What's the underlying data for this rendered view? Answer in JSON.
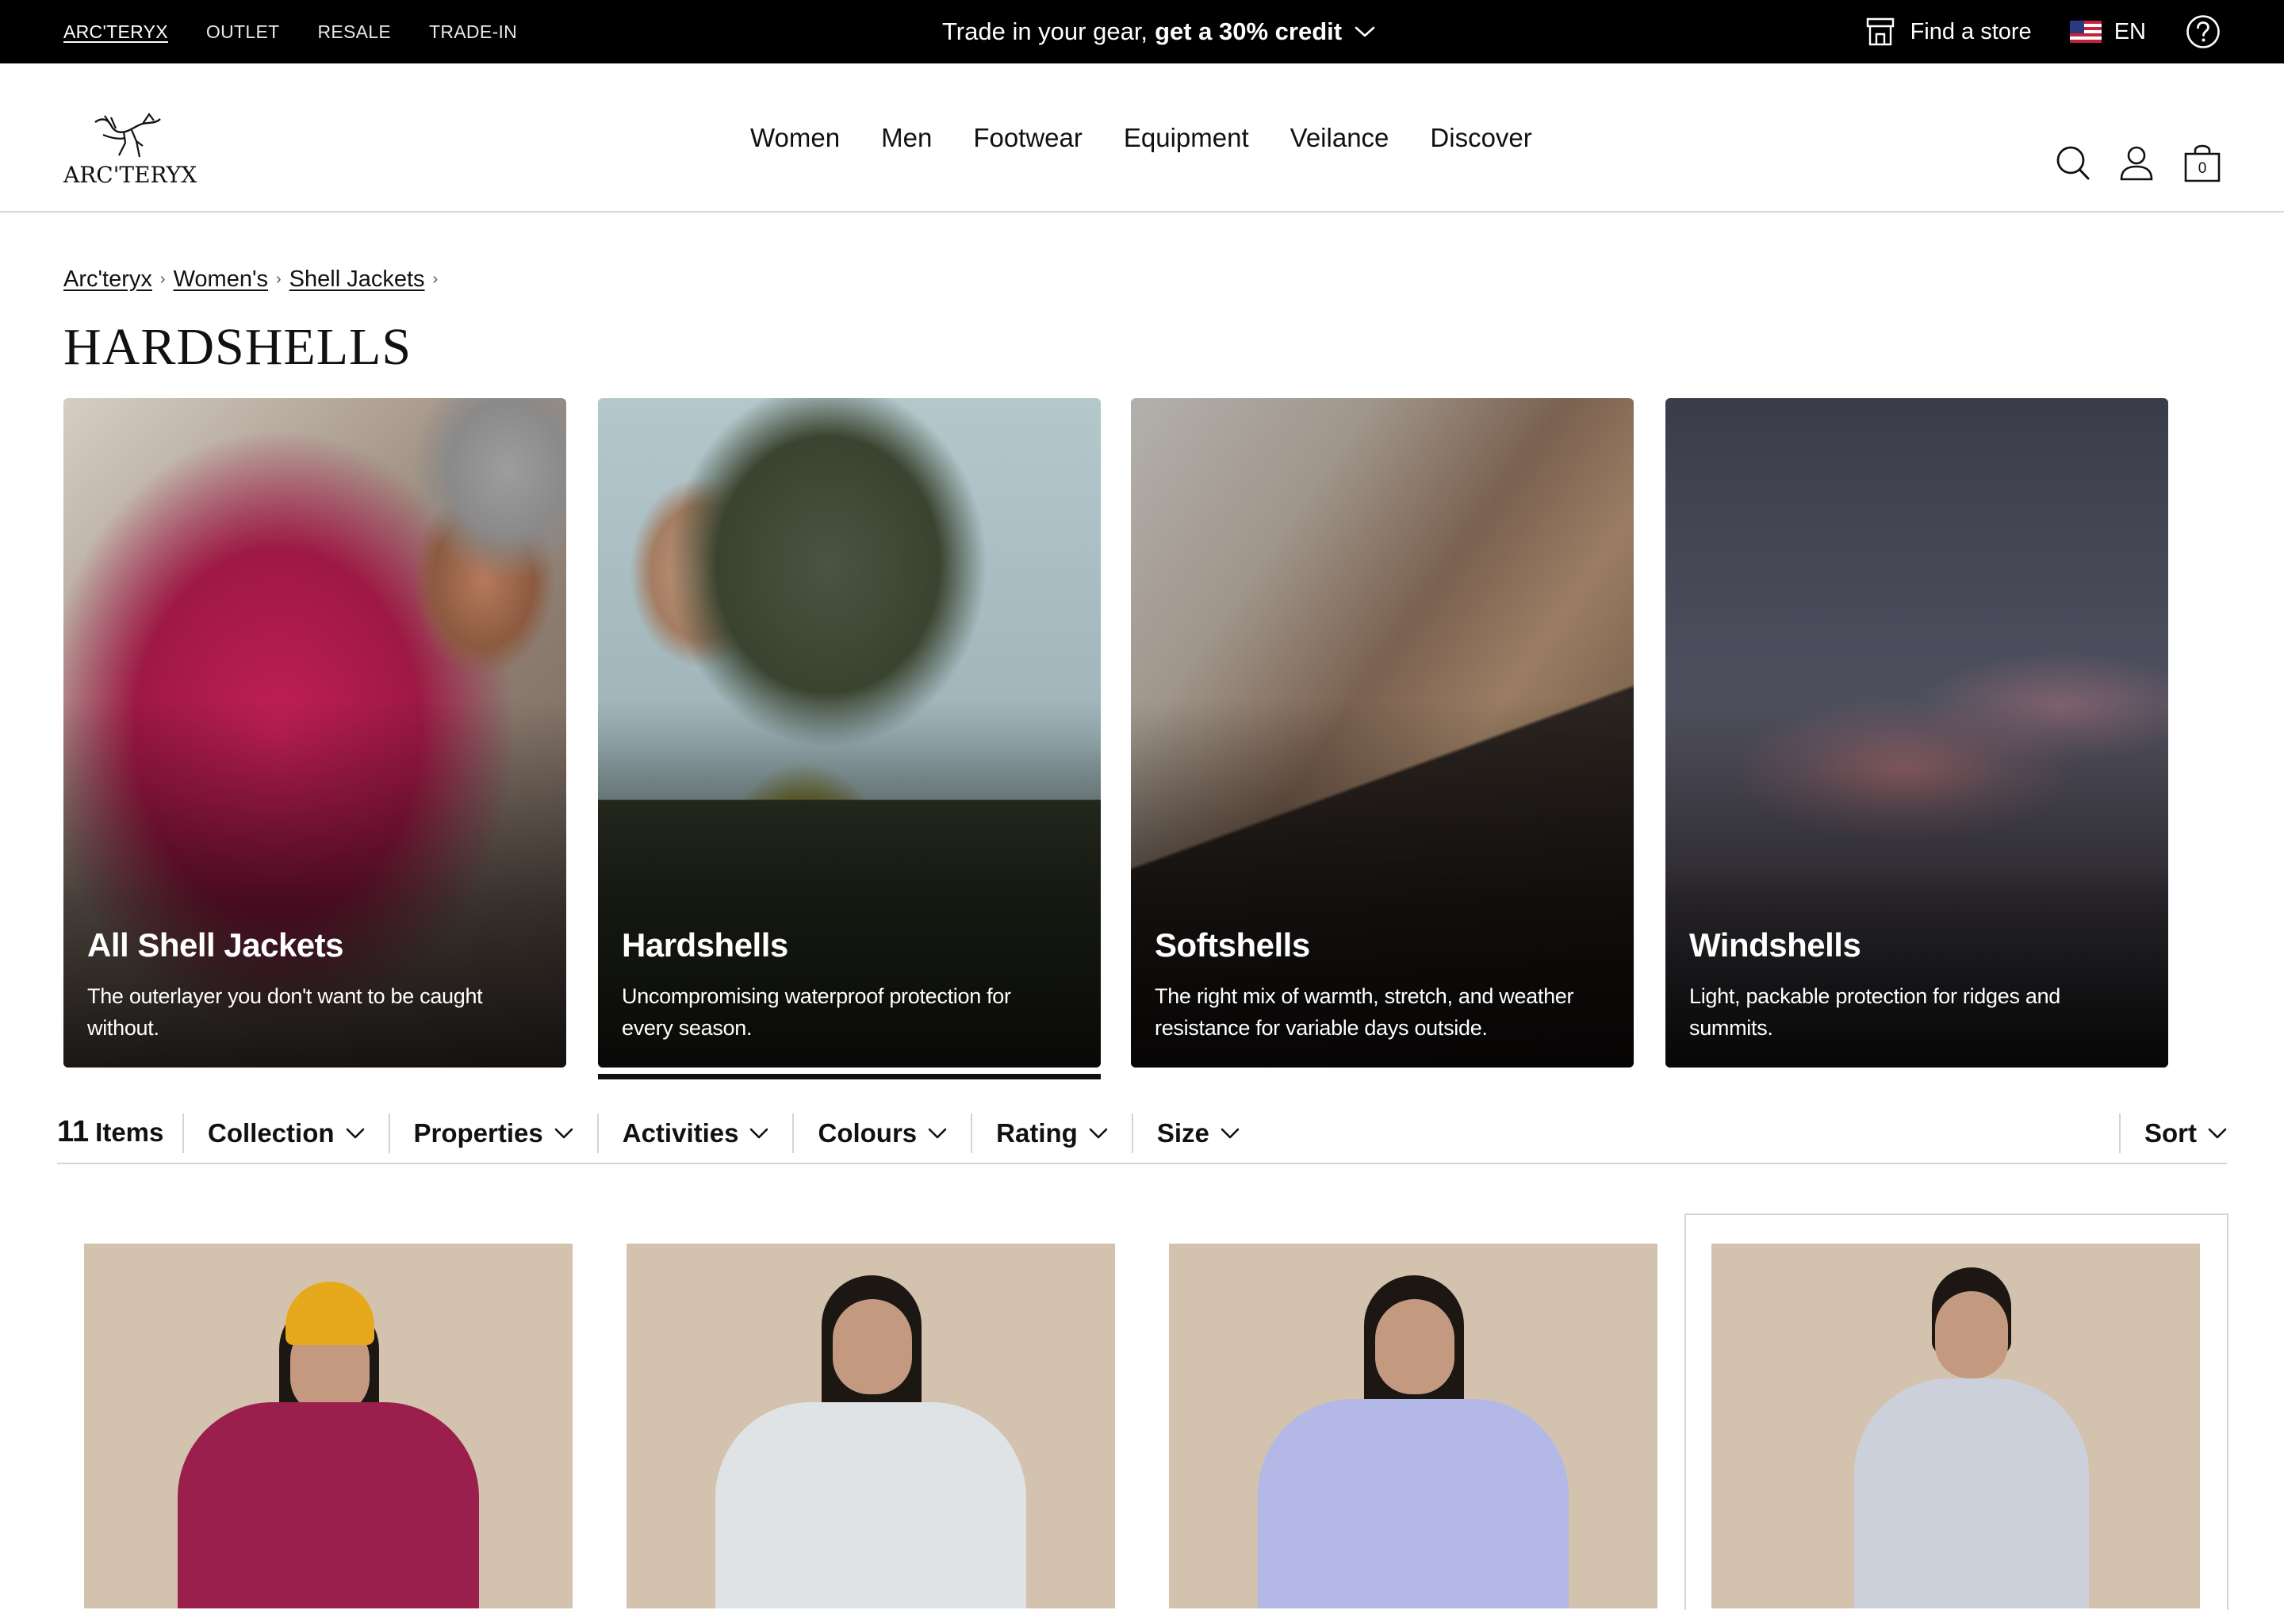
{
  "topbar": {
    "brand_links": [
      "ARC'TERYX",
      "OUTLET",
      "RESALE",
      "TRADE-IN"
    ],
    "promo_text": "Trade in your gear,",
    "promo_bold": "get a 30% credit",
    "find_store": "Find a store",
    "language": "EN"
  },
  "header": {
    "logo_text": "ARC'TERYX",
    "nav": [
      "Women",
      "Men",
      "Footwear",
      "Equipment",
      "Veilance",
      "Discover"
    ],
    "cart_count": "0"
  },
  "breadcrumb": [
    "Arc'teryx",
    "Women's",
    "Shell Jackets"
  ],
  "page_title": "HARDSHELLS",
  "categories": [
    {
      "title": "All Shell Jackets",
      "desc": "The outerlayer you don't want to be caught without."
    },
    {
      "title": "Hardshells",
      "desc": "Uncompromising waterproof protection for every season."
    },
    {
      "title": "Softshells",
      "desc": "The right mix of warmth, stretch, and weather resistance for variable days outside."
    },
    {
      "title": "Windshells",
      "desc": "Light, packable protection for ridges and summits."
    }
  ],
  "active_category": "Hardshells",
  "filterbar": {
    "count": "11",
    "count_label": "Items",
    "filters": [
      "Collection",
      "Properties",
      "Activities",
      "Colours",
      "Rating",
      "Size"
    ],
    "sort_label": "Sort"
  },
  "colors": {
    "topbar_bg": "#000000",
    "accent": "#111111",
    "divider": "#d4d4d4"
  },
  "products": [
    {
      "jacket_color": "#9b1f4c",
      "accessory": "yellow beanie"
    },
    {
      "jacket_color": "#dfe3e6",
      "accessory": "none"
    },
    {
      "jacket_color": "#b3b8e6",
      "accessory": "none"
    },
    {
      "jacket_color": "#ccd0da",
      "accessory": "black headband"
    }
  ]
}
